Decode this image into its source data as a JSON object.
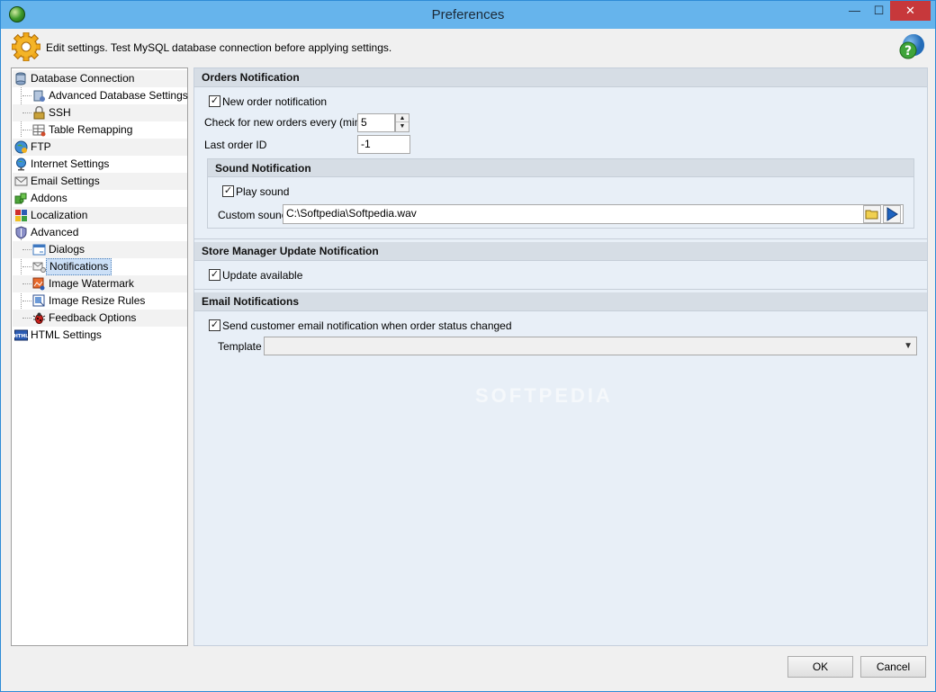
{
  "window": {
    "title": "Preferences",
    "controls": {
      "minimize": "—",
      "maximize": "☐",
      "close": "✕"
    }
  },
  "info_bar": {
    "text": "Edit settings. Test MySQL database connection before applying settings.",
    "icon": "gear-icon",
    "help_icon": "help-icon"
  },
  "tree": {
    "items": [
      {
        "label": "Database Connection",
        "icon": "database-icon",
        "level": 0
      },
      {
        "label": "Advanced Database Settings",
        "icon": "database-settings-icon",
        "level": 1
      },
      {
        "label": "SSH",
        "icon": "lock-icon",
        "level": 1
      },
      {
        "label": "Table Remapping",
        "icon": "table-icon",
        "level": 1
      },
      {
        "label": "FTP",
        "icon": "ftp-globe-icon",
        "level": 0
      },
      {
        "label": "Internet Settings",
        "icon": "globe-icon",
        "level": 0
      },
      {
        "label": "Email Settings",
        "icon": "envelope-icon",
        "level": 0
      },
      {
        "label": "Addons",
        "icon": "puzzle-icon",
        "level": 0
      },
      {
        "label": "Localization",
        "icon": "flag-icon",
        "level": 0
      },
      {
        "label": "Advanced",
        "icon": "shield-icon",
        "level": 0
      },
      {
        "label": "Dialogs",
        "icon": "dialog-icon",
        "level": 1
      },
      {
        "label": "Notifications",
        "icon": "notification-icon",
        "level": 1,
        "selected": true
      },
      {
        "label": "Image Watermark",
        "icon": "image-watermark-icon",
        "level": 1
      },
      {
        "label": "Image Resize Rules",
        "icon": "image-resize-icon",
        "level": 1
      },
      {
        "label": "Feedback Options",
        "icon": "bug-icon",
        "level": 1
      },
      {
        "label": "HTML Settings",
        "icon": "html-icon",
        "level": 0
      }
    ]
  },
  "orders": {
    "header": "Orders Notification",
    "new_order_label": "New order notification",
    "new_order_checked": true,
    "check_every_label": "Check for new orders every (min.)",
    "check_every_value": "5",
    "last_order_label": "Last order ID",
    "last_order_value": "-1",
    "sound": {
      "header": "Sound Notification",
      "play_label": "Play sound",
      "play_checked": true,
      "custom_label": "Custom sound",
      "custom_value": "C:\\Softpedia\\Softpedia.wav"
    }
  },
  "update": {
    "header": "Store Manager Update Notification",
    "available_label": "Update available",
    "available_checked": true
  },
  "email": {
    "header": "Email Notifications",
    "send_label": "Send customer email notification when order status changed",
    "send_checked": true,
    "template_label": "Template",
    "template_value": ""
  },
  "buttons": {
    "ok": "OK",
    "cancel": "Cancel"
  },
  "watermark": "SOFTPEDIA",
  "colors": {
    "titlebar": "#66b4ec",
    "close": "#c7383b",
    "content_bg": "#e8eff7",
    "section_header": "#d6dde5",
    "selection": "#cce0f7"
  }
}
